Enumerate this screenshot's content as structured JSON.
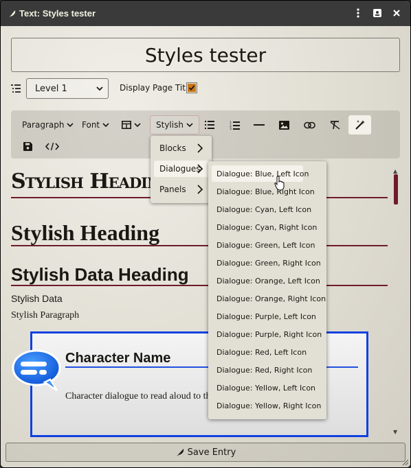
{
  "window": {
    "title": "Text: Styles tester",
    "controls": [
      "menu-dots-icon",
      "id-card-icon",
      "close-icon"
    ]
  },
  "page": {
    "title": "Styles tester",
    "level_value": "Level 1",
    "display_title_label": "Display Page Title",
    "display_title_checked": true
  },
  "toolbar": {
    "paragraph": "Paragraph",
    "font": "Font",
    "stylish": "Stylish",
    "icons": [
      "table-icon",
      "bullet-list-icon",
      "numbered-list-icon",
      "horizontal-rule-icon",
      "image-icon",
      "link-icon",
      "clear-format-icon",
      "magic-wand-icon",
      "save-icon",
      "source-code-icon"
    ]
  },
  "content": {
    "h1": "Stylish Heading",
    "h2": "Stylish Heading",
    "h3": "Stylish Data Heading",
    "data": "Stylish Data",
    "paragraph": "Stylish Paragraph",
    "dialogue_name": "Character Name",
    "dialogue_text": "Character dialogue to read aloud to the players."
  },
  "menu_stylish": [
    {
      "label": "Blocks"
    },
    {
      "label": "Dialogues"
    },
    {
      "label": "Panels"
    }
  ],
  "menu_dialogues": [
    "Dialogue: Blue, Left Icon",
    "Dialogue: Blue, Right Icon",
    "Dialogue: Cyan, Left Icon",
    "Dialogue: Cyan, Right Icon",
    "Dialogue: Green, Left Icon",
    "Dialogue: Green, Right Icon",
    "Dialogue: Orange, Left Icon",
    "Dialogue: Orange, Right Icon",
    "Dialogue: Purple, Left Icon",
    "Dialogue: Purple, Right Icon",
    "Dialogue: Red, Left Icon",
    "Dialogue: Red, Right Icon",
    "Dialogue: Yellow, Left Icon",
    "Dialogue: Yellow, Right Icon"
  ],
  "footer": {
    "save_label": "Save Entry"
  },
  "colors": {
    "titlebar": "#3a3a3a",
    "accent_rule": "#6e1a2a",
    "dialogue_border": "#1040e0",
    "checkbox_check": "#c9771b"
  }
}
